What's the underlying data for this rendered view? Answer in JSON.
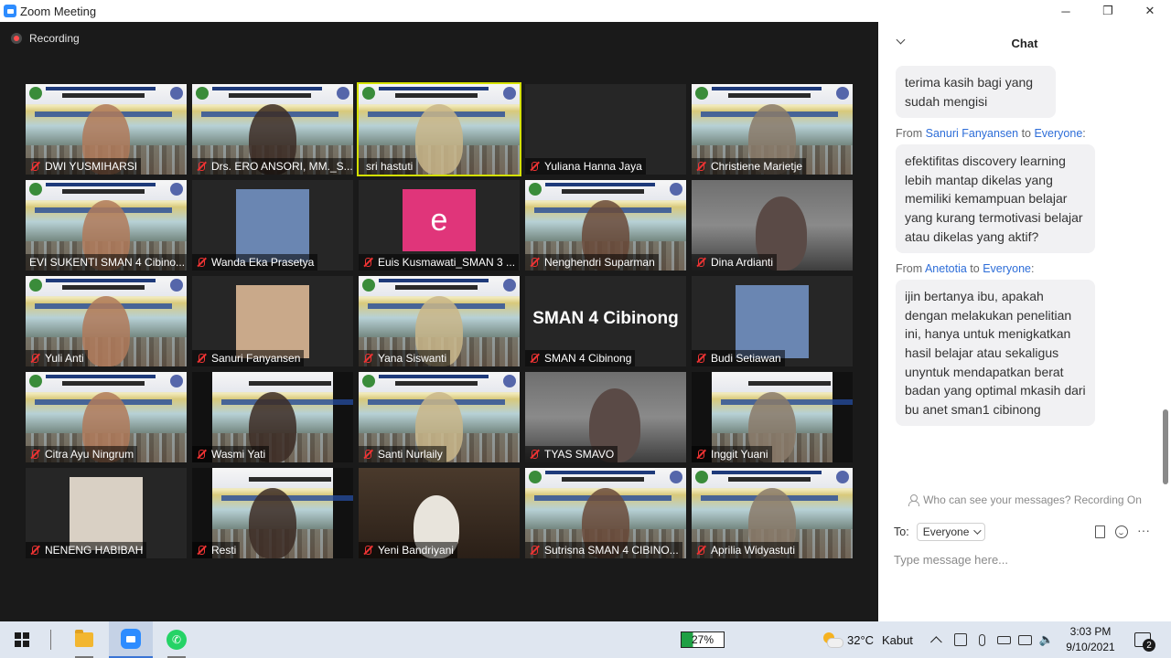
{
  "window": {
    "title": "Zoom Meeting",
    "minimize": "─",
    "restore": "❐",
    "close": "✕"
  },
  "meeting": {
    "recording_label": "Recording",
    "participants": [
      {
        "name": "DWI YUSMIHARSI",
        "muted": true,
        "scene": "webinar"
      },
      {
        "name": "Drs. ERO ANSORI, MM._S...",
        "muted": true,
        "scene": "webinar"
      },
      {
        "name": "sri hastuti",
        "muted": false,
        "scene": "webinar",
        "active": true
      },
      {
        "name": "Yuliana Hanna Jaya",
        "muted": true,
        "scene": "dark"
      },
      {
        "name": "Christiene Marietje",
        "muted": true,
        "scene": "webinar"
      },
      {
        "name": "EVI SUKENTI SMAN 4 Cibino...",
        "muted": false,
        "scene": "webinar"
      },
      {
        "name": "Wanda Eka Prasetya",
        "muted": true,
        "scene": "photo"
      },
      {
        "name": "Euis Kusmawati_SMAN 3 ...",
        "muted": true,
        "scene": "avatar",
        "avatar_letter": "e"
      },
      {
        "name": "Nenghendri Suparman",
        "muted": true,
        "scene": "webinar"
      },
      {
        "name": "Dina Ardianti",
        "muted": true,
        "scene": "room"
      },
      {
        "name": "Yuli Anti",
        "muted": true,
        "scene": "webinar"
      },
      {
        "name": "Sanuri Fanyansen",
        "muted": true,
        "scene": "photo"
      },
      {
        "name": "Yana Siswanti",
        "muted": true,
        "scene": "webinar"
      },
      {
        "name": "SMAN 4 Cibinong",
        "muted": true,
        "scene": "text",
        "display_text": "SMAN 4 Cibinong"
      },
      {
        "name": "Budi Setiawan",
        "muted": true,
        "scene": "photo"
      },
      {
        "name": "Citra Ayu Ningrum",
        "muted": true,
        "scene": "webinar"
      },
      {
        "name": "Wasmi Yati",
        "muted": true,
        "scene": "webinar-narrow"
      },
      {
        "name": "Santi Nurlaily",
        "muted": true,
        "scene": "webinar"
      },
      {
        "name": "TYAS SMAVO",
        "muted": true,
        "scene": "room"
      },
      {
        "name": "Inggit Yuani",
        "muted": true,
        "scene": "webinar-narrow"
      },
      {
        "name": "NENENG HABIBAH",
        "muted": true,
        "scene": "photo"
      },
      {
        "name": "Resti",
        "muted": true,
        "scene": "webinar-narrow"
      },
      {
        "name": "Yeni Bandriyani",
        "muted": true,
        "scene": "brown"
      },
      {
        "name": "Sutrisna SMAN 4 CIBINO...",
        "muted": true,
        "scene": "webinar"
      },
      {
        "name": "Aprilia Widyastuti",
        "muted": true,
        "scene": "webinar"
      }
    ]
  },
  "chat": {
    "title": "Chat",
    "messages": [
      {
        "from": "",
        "to": "",
        "text": "terima kasih bagi yang sudah mengisi"
      },
      {
        "from": "Sanuri Fanyansen",
        "to": "Everyone",
        "text": "efektifitas discovery learning lebih mantap dikelas yang memiliki kemampuan belajar yang kurang termotivasi belajar atau dikelas yang aktif?"
      },
      {
        "from": "Anetotia",
        "to": "Everyone",
        "text": "ijin bertanya ibu, apakah dengan melakukan penelitian ini, hanya untuk menigkatkan hasil belajar atau sekaligus unyntuk mendapatkan berat badan yang optimal mkasih dari bu anet sman1 cibinong"
      }
    ],
    "from_prefix": "From",
    "to_word": "to",
    "privacy_text": "Who can see your messages? Recording On",
    "to_label": "To:",
    "recipient": "Everyone",
    "input_placeholder": "Type message here...",
    "more_label": "···"
  },
  "taskbar": {
    "battery_percent": "27%",
    "battery_level": 0.27,
    "temperature": "32°C",
    "weather": "Kabut",
    "time": "3:03 PM",
    "date": "9/10/2021",
    "notification_count": "2"
  }
}
